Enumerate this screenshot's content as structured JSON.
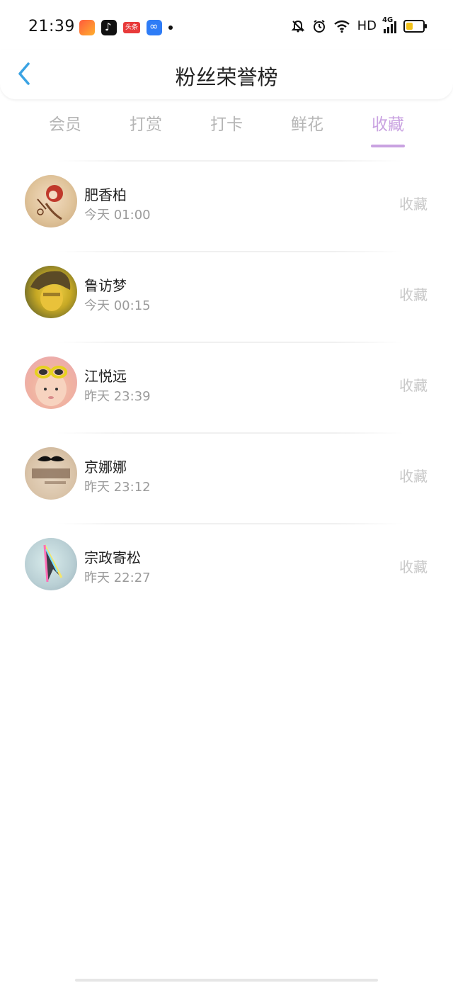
{
  "status_bar": {
    "time": "21:39",
    "app_icons": [
      "app-icon-1",
      "douyin-icon",
      "toutiao-icon",
      "infinity-icon"
    ],
    "toutiao_label": "头条",
    "hd": "HD",
    "network": "4G"
  },
  "nav": {
    "title": "粉丝荣誉榜"
  },
  "tabs": [
    {
      "label": "会员",
      "active": false
    },
    {
      "label": "打赏",
      "active": false
    },
    {
      "label": "打卡",
      "active": false
    },
    {
      "label": "鲜花",
      "active": false
    },
    {
      "label": "收藏",
      "active": true
    }
  ],
  "list": [
    {
      "name": "肥香柏",
      "time": "今天 01:00",
      "action": "收藏"
    },
    {
      "name": "鲁访梦",
      "time": "今天 00:15",
      "action": "收藏"
    },
    {
      "name": "江悦远",
      "time": "昨天 23:39",
      "action": "收藏"
    },
    {
      "name": "京娜娜",
      "time": "昨天 23:12",
      "action": "收藏"
    },
    {
      "name": "宗政寄松",
      "time": "昨天 22:27",
      "action": "收藏"
    }
  ],
  "colors": {
    "accent": "#c9a2e1",
    "back_arrow": "#3aa3e3",
    "inactive_tab": "#b5b5b5"
  }
}
